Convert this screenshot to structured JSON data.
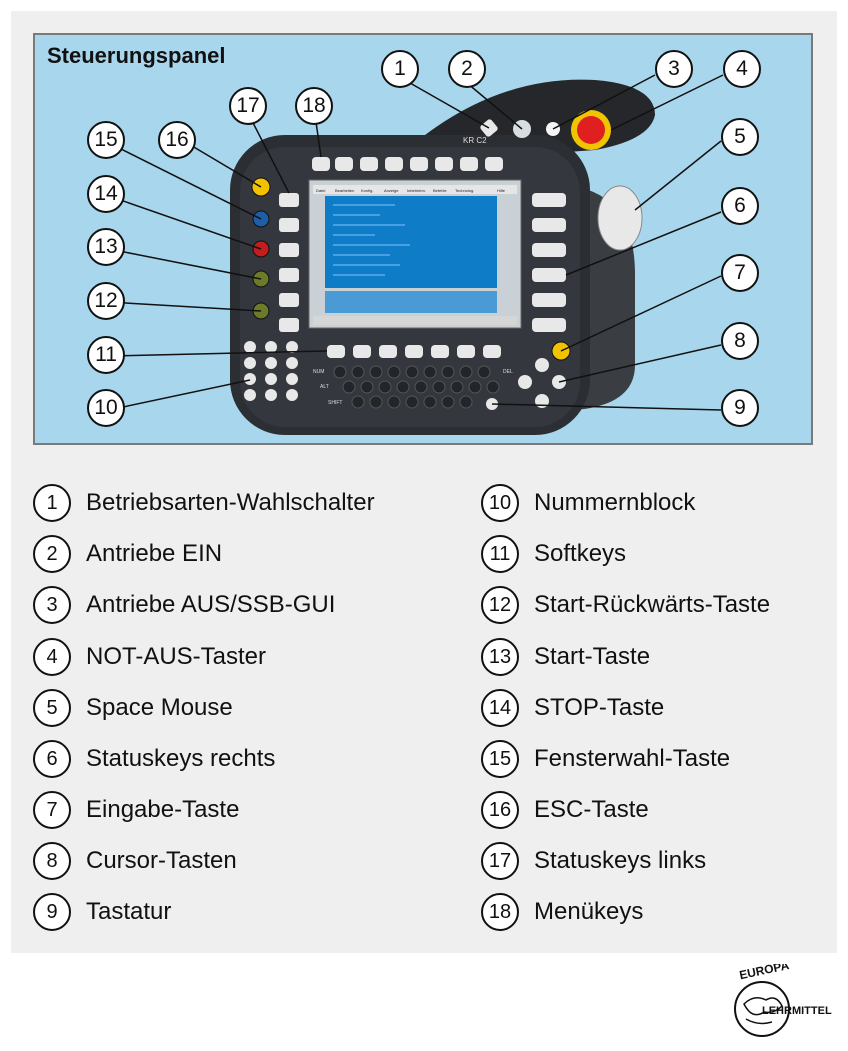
{
  "figure": {
    "title": "Steuerungspanel",
    "device_label": "KR C2",
    "screen_menu": [
      "Datei",
      "Bearbeiten",
      "Konfig.",
      "Anzeige",
      "Inbetriebn.",
      "Befehle",
      "Technolog.",
      "Hilfe"
    ],
    "keyboard_labels": {
      "num": "NUM",
      "alt": "ALT",
      "shift": "SHIFT",
      "del": "DEL"
    },
    "callouts": [
      "1",
      "2",
      "3",
      "4",
      "5",
      "6",
      "7",
      "8",
      "9",
      "10",
      "11",
      "12",
      "13",
      "14",
      "15",
      "16",
      "17",
      "18"
    ]
  },
  "legend": {
    "left": [
      {
        "num": "1",
        "text": "Betriebsarten-Wahlschalter"
      },
      {
        "num": "2",
        "text": "Antriebe EIN"
      },
      {
        "num": "3",
        "text": "Antriebe AUS/SSB-GUI"
      },
      {
        "num": "4",
        "text": "NOT-AUS-Taster"
      },
      {
        "num": "5",
        "text": "Space Mouse"
      },
      {
        "num": "6",
        "text": "Statuskeys rechts"
      },
      {
        "num": "7",
        "text": "Eingabe-Taste"
      },
      {
        "num": "8",
        "text": "Cursor-Tasten"
      },
      {
        "num": "9",
        "text": "Tastatur"
      }
    ],
    "right": [
      {
        "num": "10",
        "text": "Nummernblock"
      },
      {
        "num": "11",
        "text": "Softkeys"
      },
      {
        "num": "12",
        "text": "Start-Rückwärts-Taste"
      },
      {
        "num": "13",
        "text": "Start-Taste"
      },
      {
        "num": "14",
        "text": "STOP-Taste"
      },
      {
        "num": "15",
        "text": "Fensterwahl-Taste"
      },
      {
        "num": "16",
        "text": "ESC-Taste"
      },
      {
        "num": "17",
        "text": "Statuskeys links"
      },
      {
        "num": "18",
        "text": "Menükeys"
      }
    ]
  },
  "logo": {
    "top": "EUROPA",
    "bottom": "LEHRMITTEL"
  },
  "colors": {
    "panel_bg": "#a8d6ec",
    "sheet_bg": "#efefef",
    "estop": "#e02020",
    "yellow_key": "#f2c200",
    "blue_key": "#1c5fa8",
    "red_key": "#c41d1d",
    "green_key": "#6d7a2a",
    "screen": "#0f7cc8"
  }
}
